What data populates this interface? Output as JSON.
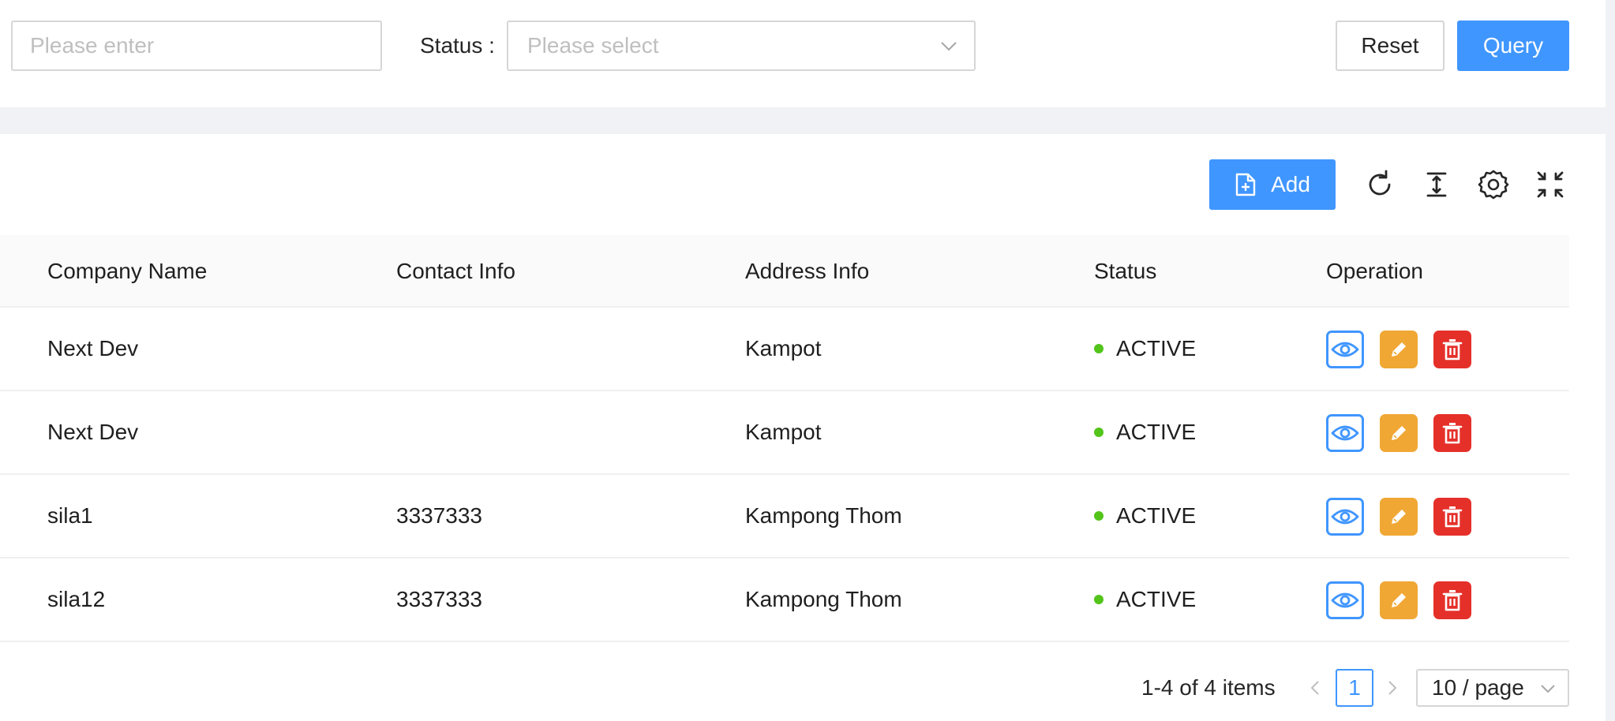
{
  "search": {
    "keyword_placeholder": "Please enter",
    "status_label": "Status :",
    "status_placeholder": "Please select",
    "reset_label": "Reset",
    "query_label": "Query"
  },
  "toolbar": {
    "add_label": "Add",
    "icons": [
      "reload-icon",
      "column-height-icon",
      "setting-icon",
      "fullscreen-icon"
    ]
  },
  "table": {
    "columns": [
      "Company Name",
      "Contact Info",
      "Address Info",
      "Status",
      "Operation"
    ],
    "rows": [
      {
        "company": "Next Dev",
        "contact": "",
        "address": "Kampot",
        "status": "ACTIVE"
      },
      {
        "company": "Next Dev",
        "contact": "",
        "address": "Kampot",
        "status": "ACTIVE"
      },
      {
        "company": "sila1",
        "contact": "3337333",
        "address": "Kampong Thom",
        "status": "ACTIVE"
      },
      {
        "company": "sila12",
        "contact": "3337333",
        "address": "Kampong Thom",
        "status": "ACTIVE"
      }
    ],
    "operations": [
      "view-icon",
      "edit-icon",
      "delete-icon"
    ]
  },
  "pagination": {
    "total_text": "1-4 of 4 items",
    "current_page": "1",
    "page_size": "10 / page"
  },
  "colors": {
    "primary": "#4096ff",
    "edit": "#f0a734",
    "delete": "#e5302a",
    "status_active": "#52c41a"
  }
}
